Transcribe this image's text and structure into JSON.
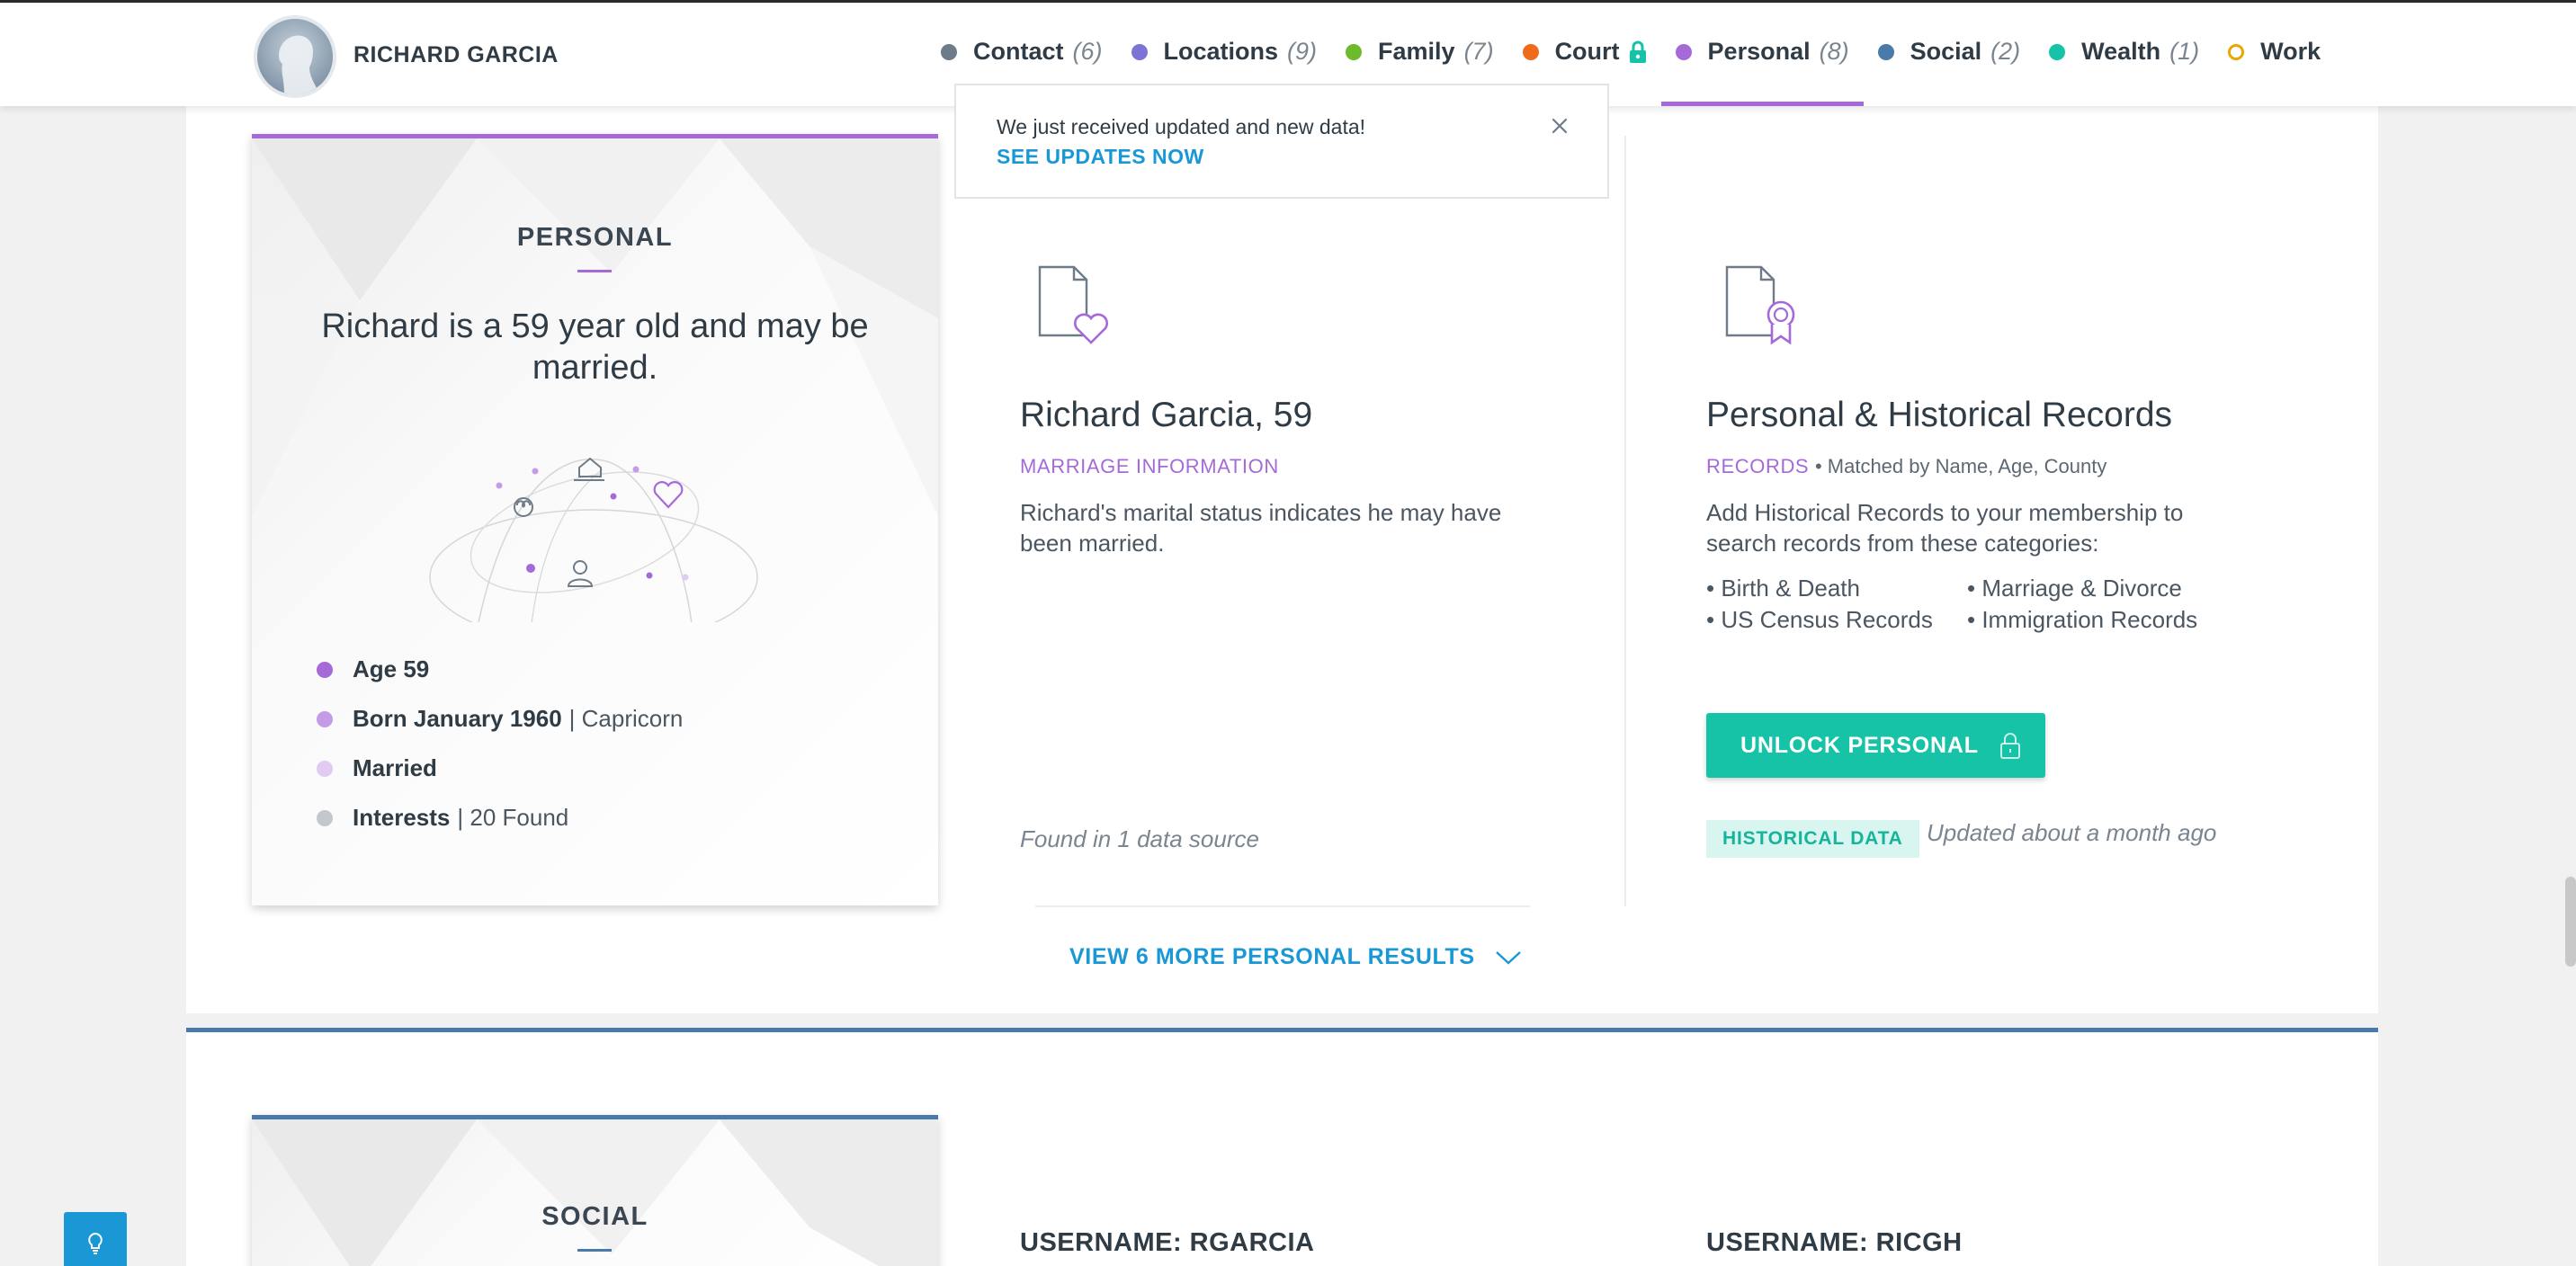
{
  "header": {
    "person_name": "RICHARD GARCIA",
    "tabs": [
      {
        "label": "Contact",
        "count": "(6)",
        "color": "#6e7b88"
      },
      {
        "label": "Locations",
        "count": "(9)",
        "color": "#7b74d6"
      },
      {
        "label": "Family",
        "count": "(7)",
        "color": "#6dbb2a"
      },
      {
        "label": "Court",
        "count": "",
        "color": "#f06a1c"
      },
      {
        "label": "Personal",
        "count": "(8)",
        "color": "#a56ad8"
      },
      {
        "label": "Social",
        "count": "(2)",
        "color": "#4a7aaa"
      },
      {
        "label": "Wealth",
        "count": "(1)",
        "color": "#16c3a7"
      },
      {
        "label": "Work",
        "count": "",
        "color": "#e9a800"
      }
    ],
    "active_tab": "Personal"
  },
  "notification": {
    "text": "We just received updated and new data!",
    "link": "SEE UPDATES NOW"
  },
  "personal_card": {
    "title": "PERSONAL",
    "summary": "Richard is a 59 year old and may be married.",
    "facts": [
      {
        "label": "Age 59",
        "suffix": "",
        "color": "#a56ad8"
      },
      {
        "label": "Born January 1960",
        "suffix": "| Capricorn",
        "color": "#c39be6"
      },
      {
        "label": "Married",
        "suffix": "",
        "color": "#e1cbf3"
      },
      {
        "label": "Interests",
        "suffix": "| 20 Found",
        "color": "#c4c8cc"
      }
    ]
  },
  "marriage_result": {
    "title": "Richard Garcia, 59",
    "tag": "MARRIAGE INFORMATION",
    "description": "Richard's marital status indicates he may have been married.",
    "found": "Found in 1 data source"
  },
  "records_result": {
    "title": "Personal & Historical Records",
    "tag": "RECORDS",
    "matched": "Matched by Name, Age, County",
    "description": "Add Historical Records to your membership to search records from these categories:",
    "categories": [
      "Birth & Death",
      "Marriage & Divorce",
      "US Census Records",
      "Immigration Records"
    ],
    "unlock_label": "UNLOCK PERSONAL",
    "badge": "HISTORICAL DATA",
    "updated": "Updated about a month ago"
  },
  "more_results": "VIEW 6 MORE PERSONAL RESULTS",
  "social_card": {
    "title": "SOCIAL",
    "usernames": [
      "USERNAME: RGARCIA",
      "USERNAME: RICGH"
    ]
  }
}
